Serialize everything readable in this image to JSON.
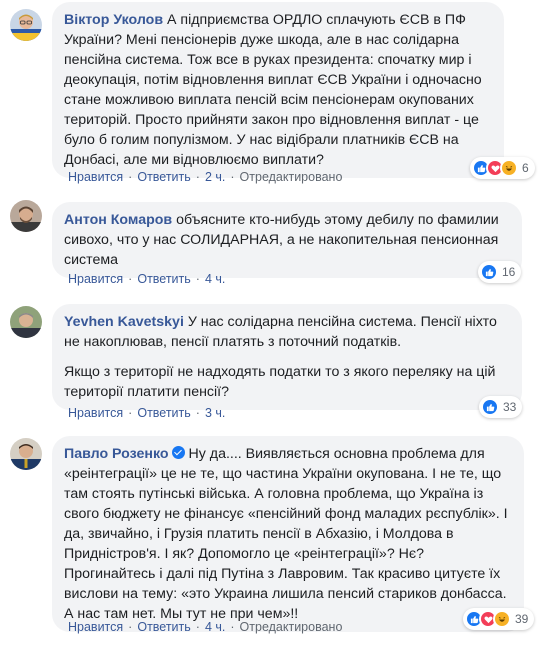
{
  "comments": [
    {
      "author": "Віктор Уколов",
      "verified": false,
      "text": "А підприємства ОРДЛО сплачують ЄСВ в ПФ України? Мені пенсіонерів дуже шкода, але в нас солідарна пенсійна система. Тож все в руках президента: спочатку мир і деокупація, потім відновлення виплат ЄСВ України і одночасно стане можливою виплата пенсій всім пенсіонерам окупованих територій. Просто прийняти закон про відновлення виплат - це було б голим популізмом. У нас відібрали платників ЄСВ на Донбасі, але ми відновлюємо виплати?",
      "like_label": "Нравится",
      "reply_label": "Ответить",
      "time": "2 ч.",
      "edited": "Отредактировано",
      "reactions": [
        "like",
        "love",
        "haha"
      ],
      "reaction_count": "6"
    },
    {
      "author": "Антон Комаров",
      "verified": false,
      "text": "объясните кто-нибудь этому дебилу по фамилии сивохо, что у нас СОЛИДАРНАЯ, а не накопительная пенсионная система",
      "like_label": "Нравится",
      "reply_label": "Ответить",
      "time": "4 ч.",
      "reactions": [
        "like"
      ],
      "reaction_count": "16"
    },
    {
      "author": "Yevhen Kavetskyi",
      "verified": false,
      "text": "У нас солідарна пенсійна система. Пенсії ніхто не накоплював, пенсії платять з поточний податків.",
      "text2": "Якщо з території не надходять податки то з якого переляку на цій території платити пенсії?",
      "like_label": "Нравится",
      "reply_label": "Ответить",
      "time": "3 ч.",
      "reactions": [
        "like"
      ],
      "reaction_count": "33"
    },
    {
      "author": "Павло Розенко",
      "verified": true,
      "text": "Ну да.... Виявляється основна проблема для «реінтеграції» це не те, що частина України окупована. І не те, що там стоять путінські війська. А головна проблема, що Україна із свого бюджету не фінансує «пенсійний фонд маладих рєспублік». І да, звичайно, і Грузія платить пенсії в Абхазію, і Молдова в Придністров'я. І як? Допомогло це «реінтеграції»? Нє? Прогинайтесь і далі під Путіна з Лавровим. Так красиво цитуєте їх вислови на тему: «это Украина лишила пенсий стариков донбасса. А нас там нет. Мы тут не при чем»!!",
      "like_label": "Нравится",
      "reply_label": "Ответить",
      "time": "4 ч.",
      "edited": "Отредактировано",
      "reactions": [
        "like",
        "love",
        "haha"
      ],
      "reaction_count": "39"
    }
  ],
  "colors": {
    "author": "#385898",
    "bubble": "#f2f3f5",
    "like": "#1877f2",
    "love": "#f33e58",
    "haha": "#f7b125"
  }
}
